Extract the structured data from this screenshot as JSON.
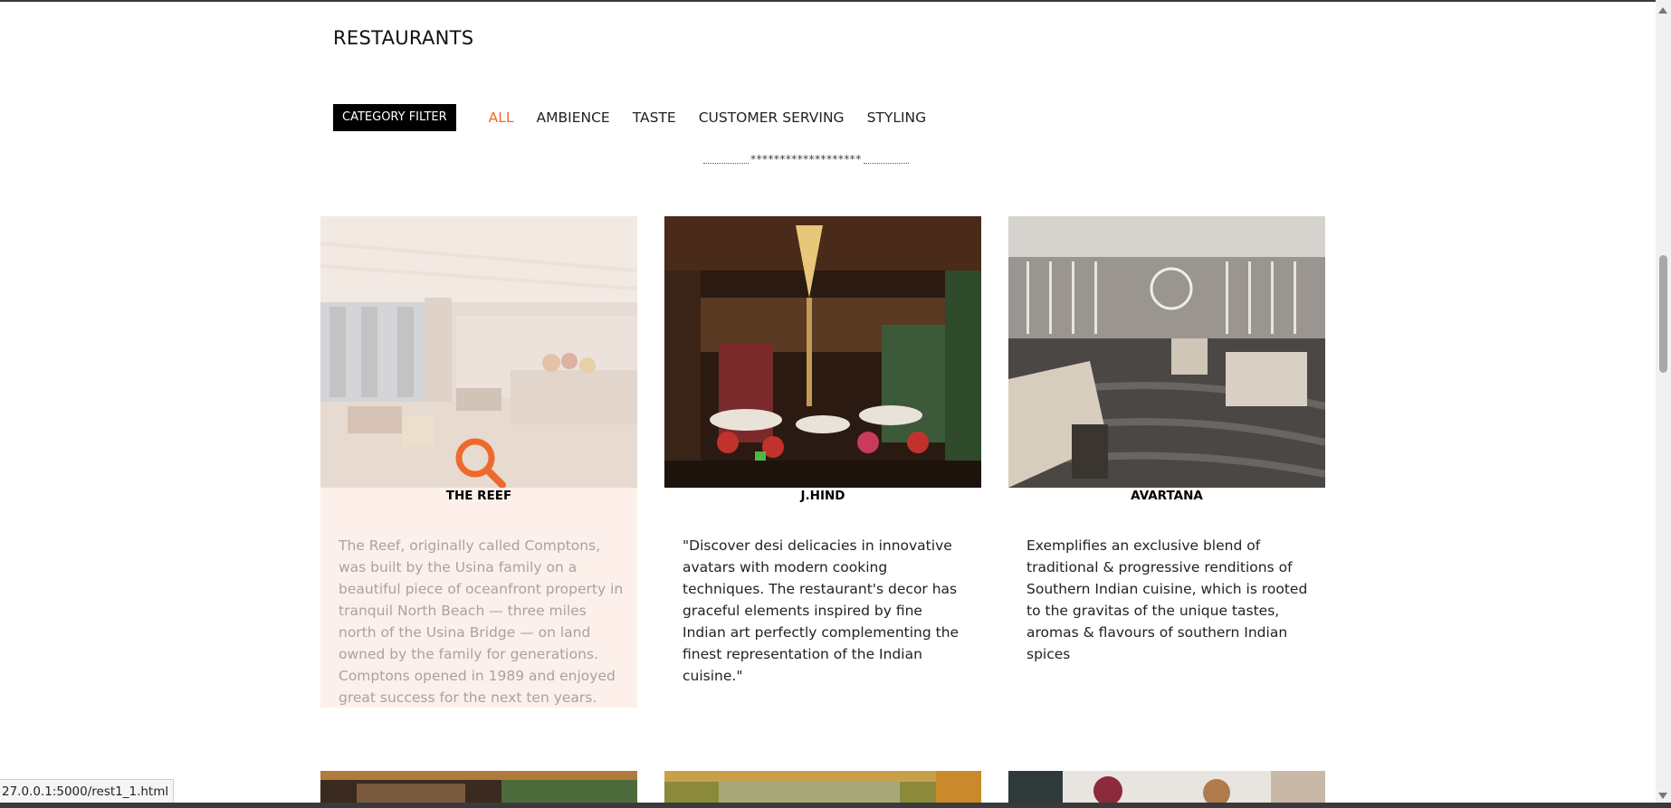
{
  "page": {
    "title": "RESTAURANTS"
  },
  "filter": {
    "badge": "CATEGORY FILTER",
    "links": [
      "ALL",
      "AMBIENCE",
      "TASTE",
      "CUSTOMER SERVING",
      "STYLING"
    ],
    "active": "ALL"
  },
  "divider": {
    "stars": "*******************"
  },
  "cards": [
    {
      "title": "THE REEF",
      "description": "The Reef, originally called Comptons, was built by the Usina family on a beautiful piece of oceanfront property in tranquil North Beach — three miles north of the Usina Bridge — on land owned by the family for generations. Comptons opened in 1989 and enjoyed great success for the next ten years.",
      "hovered": true,
      "hover_icon": "search-icon"
    },
    {
      "title": "J.HIND",
      "description": "\"Discover desi delicacies in innovative avatars with modern cooking techniques. The restaurant's decor has graceful elements inspired by fine Indian art perfectly complementing the finest representation of the Indian cuisine.\""
    },
    {
      "title": "AVARTANA",
      "description": "Exemplifies an exclusive blend of traditional & progressive renditions of Southern Indian cuisine, which is rooted to the gravitas of the unique tastes, aromas & flavours of southern Indian spices"
    }
  ],
  "colors": {
    "accent": "#ee6a2c",
    "badge_bg": "#000000",
    "hover_bg": "#fdf0ea"
  },
  "status_bar": {
    "url": "27.0.0.1:5000/rest1_1.html"
  }
}
